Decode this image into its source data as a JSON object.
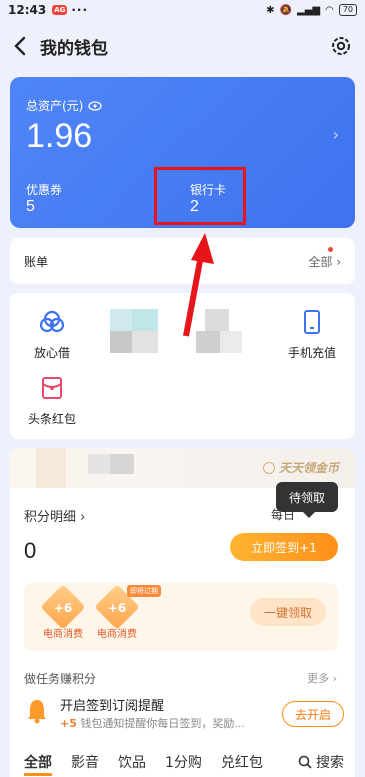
{
  "status": {
    "time": "12:43",
    "badge": "AG",
    "dots": "···",
    "battery": "70"
  },
  "header": {
    "title": "我的钱包"
  },
  "assets": {
    "label": "总资产(元)",
    "amount": "1.96",
    "coupon_label": "优惠券",
    "coupon_value": "5",
    "bank_label": "银行卡",
    "bank_value": "2"
  },
  "bill": {
    "label": "账单",
    "all": "全部"
  },
  "services": [
    {
      "label": "放心借",
      "icon": "loan-icon"
    },
    {
      "label": "手机充值",
      "icon": "phone-icon"
    },
    {
      "label": "头条红包",
      "icon": "redpacket-icon"
    }
  ],
  "banner": {
    "daily": "天天领金币"
  },
  "points": {
    "title": "积分明细",
    "value": "0",
    "daily": "每日",
    "signin": "立即签到+1",
    "tooltip": "待领取",
    "rewards": [
      {
        "value": "+6",
        "label": "电商消费"
      },
      {
        "value": "+6",
        "label": "电商消费",
        "tag": "即将过期"
      }
    ],
    "oneclick": "一键领取"
  },
  "tasks": {
    "title": "做任务赚积分",
    "more": "更多",
    "item": {
      "name": "开启签到订阅提醒",
      "plus": "+5",
      "desc": "钱包通知提醒你每日签到，奖励...",
      "button": "去开启"
    }
  },
  "tabs": [
    "全部",
    "影音",
    "饮品",
    "1分购",
    "兑红包"
  ],
  "search": "搜索"
}
